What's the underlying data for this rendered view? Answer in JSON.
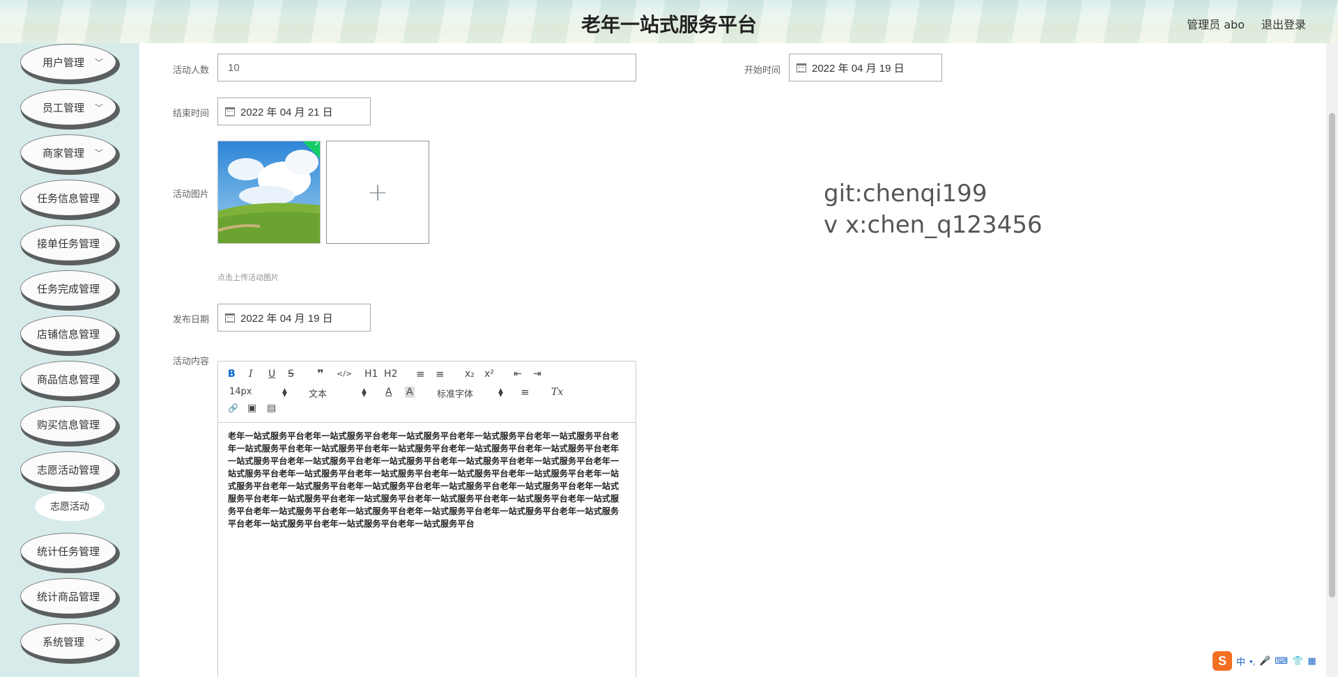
{
  "header": {
    "title": "老年一站式服务平台",
    "user": "管理员 abo",
    "logout": "退出登录"
  },
  "sidebar": {
    "items": [
      {
        "label": "用户管理",
        "chevron": true
      },
      {
        "label": "员工管理",
        "chevron": true
      },
      {
        "label": "商家管理",
        "chevron": true
      },
      {
        "label": "任务信息管理",
        "chevron": false
      },
      {
        "label": "接单任务管理",
        "chevron": false
      },
      {
        "label": "任务完成管理",
        "chevron": false
      },
      {
        "label": "店铺信息管理",
        "chevron": false
      },
      {
        "label": "商品信息管理",
        "chevron": false
      },
      {
        "label": "购买信息管理",
        "chevron": false
      },
      {
        "label": "志愿活动管理",
        "chevron": false
      },
      {
        "label": "统计任务管理",
        "chevron": false
      },
      {
        "label": "统计商品管理",
        "chevron": false
      },
      {
        "label": "系统管理",
        "chevron": true
      }
    ],
    "sub_item": "志愿活动"
  },
  "form": {
    "people_label": "活动人数",
    "people_value": "10",
    "start_label": "开始时间",
    "start_value": "2022 年 04 月 19 日",
    "end_label": "结束时间",
    "end_value": "2022 年 04 月 21 日",
    "image_label": "活动图片",
    "upload_tip": "点击上传活动图片",
    "publish_label": "发布日期",
    "publish_value": "2022 年 04 月 19 日",
    "content_label": "活动内容"
  },
  "editor": {
    "toolbar": {
      "bold": "B",
      "italic": "I",
      "underline": "U",
      "strike": "S",
      "quote": "❞",
      "code": "</>",
      "h1": "H1",
      "h2": "H2",
      "ordered_list": "≡",
      "bullet_list": "≡",
      "subscript": "x₂",
      "superscript": "x²",
      "outdent": "⇤",
      "indent": "⇥",
      "size": "14px",
      "style": "文本",
      "color": "A",
      "background": "A",
      "font": "标准字体",
      "align": "≡",
      "clear": "Tx",
      "link": "🔗",
      "image": "▣",
      "video": "▤"
    },
    "content": "老年一站式服务平台老年一站式服务平台老年一站式服务平台老年一站式服务平台老年一站式服务平台老年一站式服务平台老年一站式服务平台老年一站式服务平台老年一站式服务平台老年一站式服务平台老年一站式服务平台老年一站式服务平台老年一站式服务平台老年一站式服务平台老年一站式服务平台老年一站式服务平台老年一站式服务平台老年一站式服务平台老年一站式服务平台老年一站式服务平台老年一站式服务平台老年一站式服务平台老年一站式服务平台老年一站式服务平台老年一站式服务平台老年一站式服务平台老年一站式服务平台老年一站式服务平台老年一站式服务平台老年一站式服务平台老年一站式服务平台老年一站式服务平台老年一站式服务平台老年一站式服务平台老年一站式服务平台老年一站式服务平台老年一站式服务平台老年一站式服务平台老年一站式服务平台"
  },
  "watermark": {
    "line1": "git:chenqi199",
    "line2": "v x:chen_q123456"
  },
  "ime": {
    "logo": "S",
    "lang": "中",
    "punct": "•,"
  },
  "colors": {
    "sidebar_bg": "#d7ebea",
    "accent": "#0066cc",
    "success": "#13ce66"
  }
}
